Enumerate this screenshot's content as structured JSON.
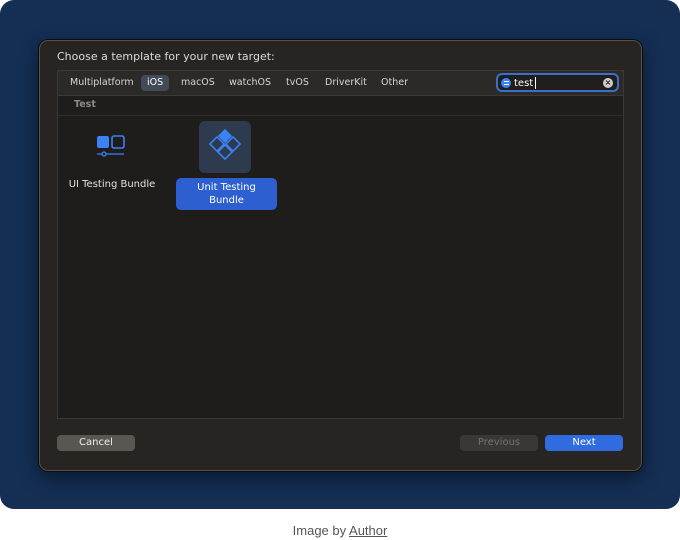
{
  "dialog": {
    "title": "Choose a template for your new target:"
  },
  "tabs": [
    {
      "label": "Multiplatform",
      "active": false
    },
    {
      "label": "iOS",
      "active": true
    },
    {
      "label": "macOS",
      "active": false
    },
    {
      "label": "watchOS",
      "active": false
    },
    {
      "label": "tvOS",
      "active": false
    },
    {
      "label": "DriverKit",
      "active": false
    },
    {
      "label": "Other",
      "active": false
    }
  ],
  "search": {
    "value": "test",
    "icon": "filter-icon",
    "clear_icon": "clear-icon"
  },
  "section": {
    "label": "Test"
  },
  "templates": [
    {
      "label": "UI Testing Bundle",
      "icon": "ui-testing-icon",
      "selected": false
    },
    {
      "label": "Unit Testing Bundle",
      "icon": "unit-testing-icon",
      "selected": true
    }
  ],
  "buttons": {
    "cancel": "Cancel",
    "previous": "Previous",
    "next": "Next"
  },
  "caption": {
    "prefix": "Image by ",
    "link": "Author"
  },
  "colors": {
    "frame": "#142e54",
    "dialog": "#272421",
    "accent": "#2f6ce0",
    "icon_blue": "#3b82f6"
  }
}
